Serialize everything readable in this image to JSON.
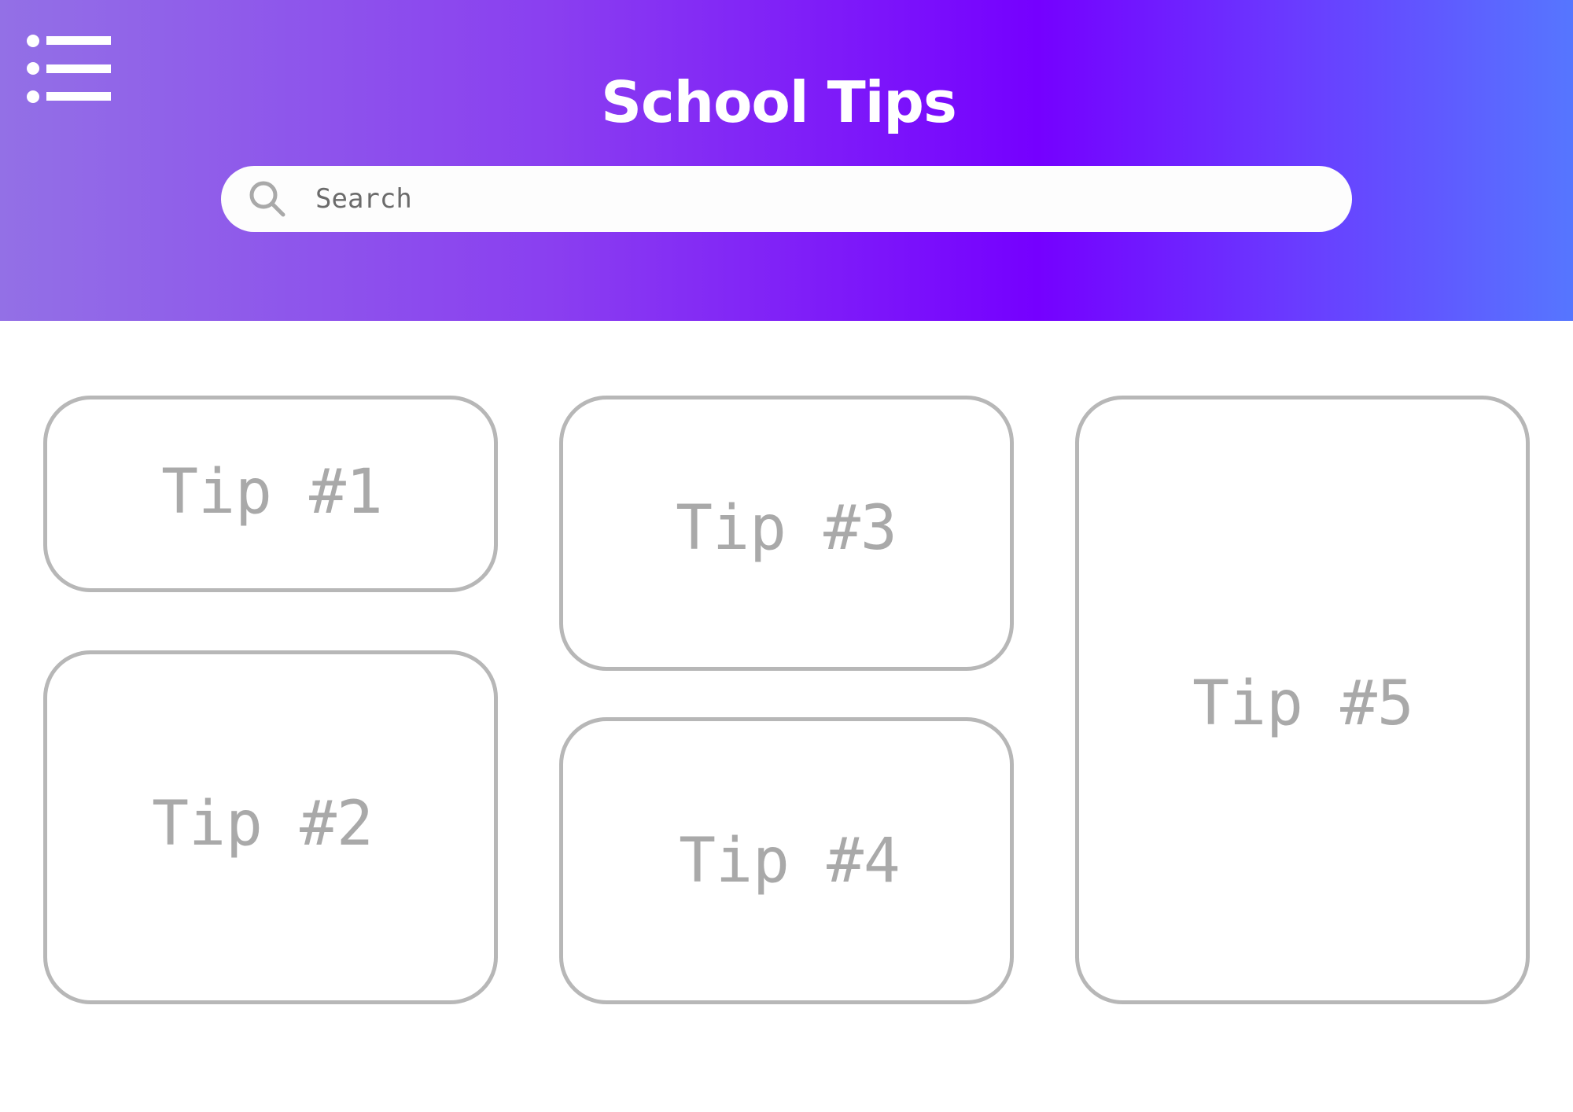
{
  "header": {
    "title": "School Tips",
    "menu_icon": "list-menu-icon",
    "gradient_colors": [
      "#9370e6",
      "#7500ff",
      "#5676ff"
    ]
  },
  "search": {
    "placeholder": "Search",
    "icon": "search-icon"
  },
  "tips": [
    {
      "label": "Tip #1"
    },
    {
      "label": "Tip #2"
    },
    {
      "label": "Tip #3"
    },
    {
      "label": "Tip #4"
    },
    {
      "label": "Tip #5"
    }
  ],
  "colors": {
    "card_border": "#b7b7b7",
    "card_text": "#a9a9a9"
  }
}
